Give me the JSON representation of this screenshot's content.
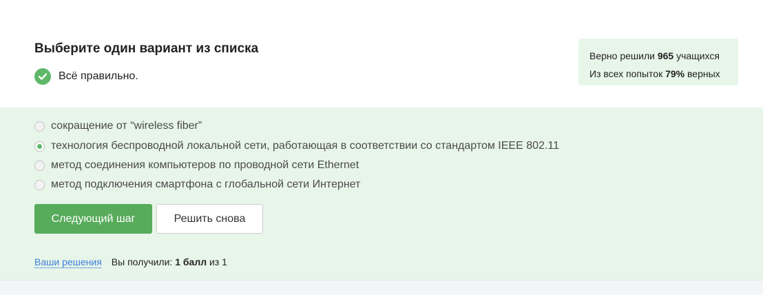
{
  "step": {
    "title": "Выберите один вариант из списка",
    "result_message": "Всё правильно."
  },
  "stats": {
    "line1_prefix": "Верно решили ",
    "line1_count": "965",
    "line1_suffix": " учащихся",
    "line2_prefix": "Из всех попыток ",
    "line2_percent": "79%",
    "line2_suffix": " верных"
  },
  "options": [
    {
      "label": "сокращение от “wireless fiber”",
      "selected": false
    },
    {
      "label": "технология беспроводной локальной сети, работающая в соответствии со стандартом IEEE 802.11",
      "selected": true
    },
    {
      "label": "метод соединения компьютеров по проводной сети Ethernet",
      "selected": false
    },
    {
      "label": "метод подключения смартфона с глобальной сети Интернет",
      "selected": false
    }
  ],
  "buttons": {
    "next_label": "Следующий шаг",
    "retry_label": "Решить снова"
  },
  "footer": {
    "solutions_link": "Ваши решения",
    "score_prefix": "Вы получили: ",
    "score_value": "1 балл",
    "score_suffix": " из 1"
  },
  "colors": {
    "accent_green": "#57ab5a",
    "success_bg": "#e8f5e9",
    "link_blue": "#3b7dd8"
  },
  "icons": {
    "result": "check-circle-icon"
  }
}
